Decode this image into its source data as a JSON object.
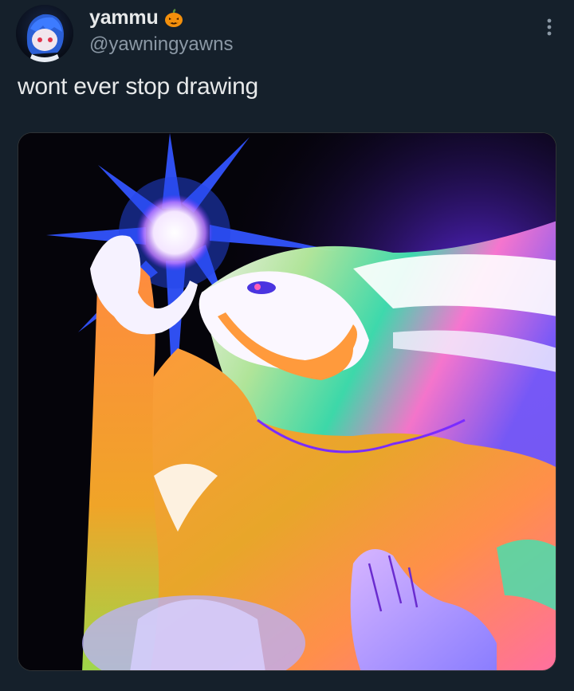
{
  "tweet": {
    "author": {
      "display_name": "yammu",
      "handle": "@yawningyawns",
      "name_emoji": "pumpkin-icon",
      "avatar": "avatar"
    },
    "text": "wont ever stop drawing",
    "menu_icon": "more-vertical-icon",
    "media": {
      "kind": "illustration"
    }
  },
  "colors": {
    "background": "#15202b",
    "text_primary": "#e7e9ea",
    "text_secondary": "#8b98a5"
  }
}
